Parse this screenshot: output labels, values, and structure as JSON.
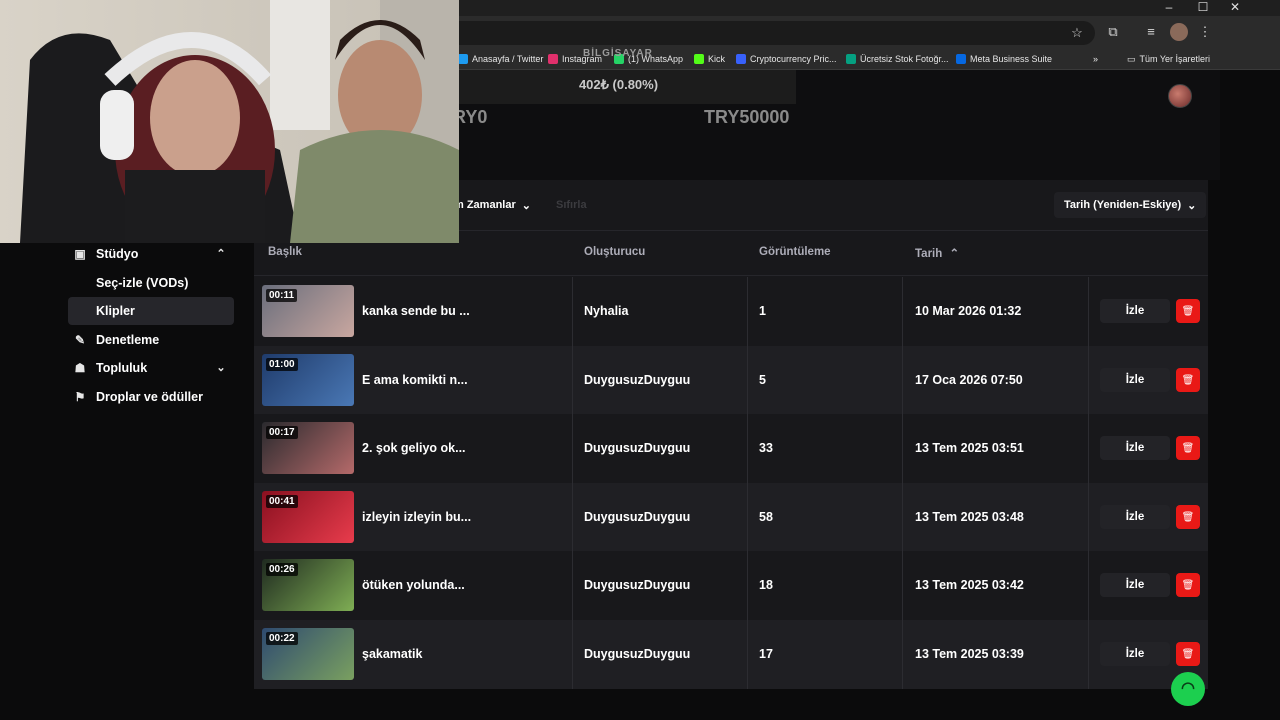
{
  "browser": {
    "window_controls": [
      "–",
      "☐",
      "✕"
    ],
    "bookmarks": [
      {
        "label": "Anasayfa / Twitter",
        "icon": "twitter-icon",
        "color": "#1d9bf0"
      },
      {
        "label": "Instagram",
        "icon": "instagram-icon",
        "color": "#e1306c"
      },
      {
        "label": "(1) WhatsApp",
        "icon": "whatsapp-icon",
        "color": "#25d366"
      },
      {
        "label": "Kick",
        "icon": "kick-icon",
        "color": "#53fc18"
      },
      {
        "label": "Cryptocurrency Pric...",
        "icon": "coinmarketcap-icon",
        "color": "#3861fb"
      },
      {
        "label": "Ücretsiz Stok Fotoğr...",
        "icon": "pexels-icon",
        "color": "#05a081"
      },
      {
        "label": "Meta Business Suite",
        "icon": "meta-icon",
        "color": "#0668e1"
      }
    ],
    "overflow_label": "»",
    "all_bookmarks_label": "Tüm Yer İşaretleri"
  },
  "goal": {
    "partial_label": "BİLGİSAYAR",
    "amount_label": "402₺ (0.80%)",
    "progress_fraction": 0.008,
    "min_label": "TRY0",
    "max_label": "TRY50000",
    "fill_color": "#2fc84a"
  },
  "filters": {
    "time_label": "m Zamanlar",
    "ghost_label": "Sıfırla",
    "sort_label": "Tarih (Yeniden-Eskiye)"
  },
  "sidebar": {
    "items": [
      {
        "label": "Stüdyo",
        "icon": "studio-icon",
        "chevron": "up",
        "sub": false,
        "active": false
      },
      {
        "label": "Seç-izle (VODs)",
        "icon": "",
        "chevron": "",
        "sub": true,
        "active": false
      },
      {
        "label": "Klipler",
        "icon": "",
        "chevron": "",
        "sub": true,
        "active": true
      },
      {
        "label": "Denetleme",
        "icon": "wrench-icon",
        "chevron": "",
        "sub": false,
        "active": false
      },
      {
        "label": "Topluluk",
        "icon": "community-icon",
        "chevron": "down",
        "sub": false,
        "active": false
      },
      {
        "label": "Droplar ve ödüller",
        "icon": "drops-icon",
        "chevron": "",
        "sub": false,
        "active": false
      }
    ]
  },
  "table": {
    "headers": {
      "title": "Başlık",
      "creator": "Oluşturucu",
      "views": "Görüntüleme",
      "date": "Tarih"
    },
    "watch_label": "İzle",
    "rows": [
      {
        "duration": "00:11",
        "title": "kanka sende bu ...",
        "creator": "Nyhalia",
        "views": "1",
        "date": "10 Mar 2026 01:32",
        "thumb_colors": [
          "#6a6e7c",
          "#c9a7a0"
        ]
      },
      {
        "duration": "01:00",
        "title": "E ama komikti n...",
        "creator": "DuygusuzDuyguu",
        "views": "5",
        "date": "17 Oca 2026 07:50",
        "thumb_colors": [
          "#1f3b6b",
          "#4a78b5"
        ]
      },
      {
        "duration": "00:17",
        "title": "2. şok geliyo ok...",
        "creator": "DuygusuzDuyguu",
        "views": "33",
        "date": "13 Tem 2025 03:51",
        "thumb_colors": [
          "#2a2a2e",
          "#b56a6a"
        ]
      },
      {
        "duration": "00:41",
        "title": "izleyin izleyin bu...",
        "creator": "DuygusuzDuyguu",
        "views": "58",
        "date": "13 Tem 2025 03:48",
        "thumb_colors": [
          "#8a1020",
          "#e83c4c"
        ]
      },
      {
        "duration": "00:26",
        "title": "ötüken yolunda...",
        "creator": "DuygusuzDuyguu",
        "views": "18",
        "date": "13 Tem 2025 03:42",
        "thumb_colors": [
          "#1f2a20",
          "#7fae54"
        ]
      },
      {
        "duration": "00:22",
        "title": "şakamatik",
        "creator": "DuygusuzDuyguu",
        "views": "17",
        "date": "13 Tem 2025 03:39",
        "thumb_colors": [
          "#2e4a70",
          "#7aa060"
        ]
      }
    ]
  },
  "colors": {
    "delete": "#e91916",
    "help_fab": "#1ccf4f"
  }
}
